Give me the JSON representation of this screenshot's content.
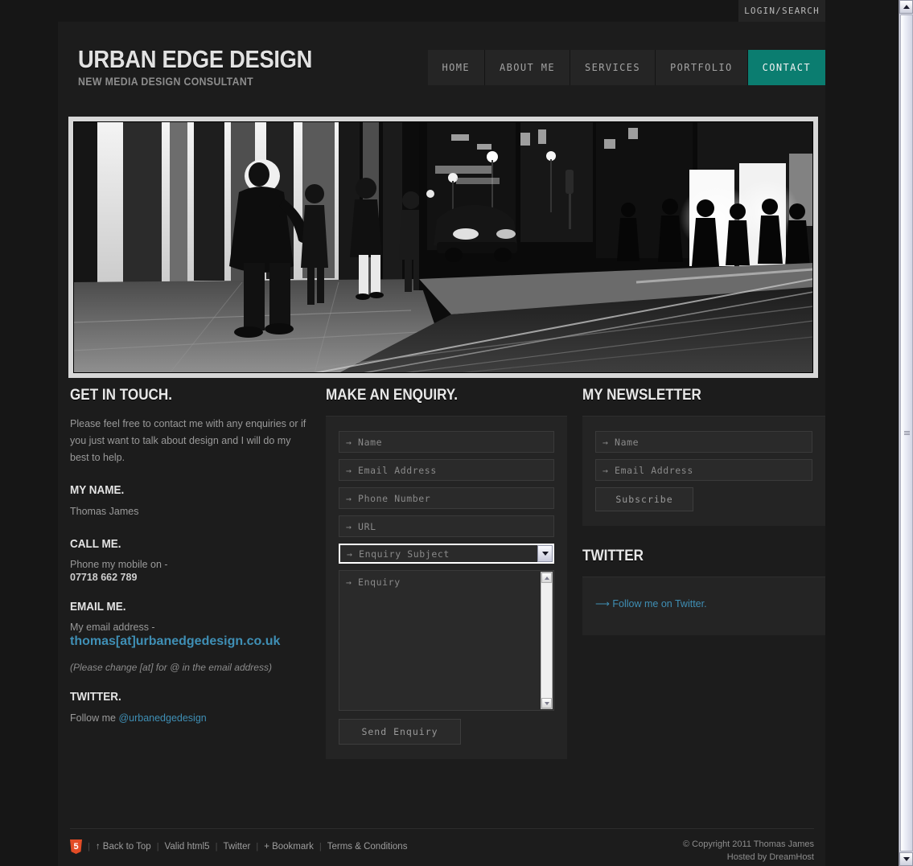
{
  "topbar": {
    "login_search": "LOGIN/SEARCH"
  },
  "brand": {
    "title": "URBAN EDGE DESIGN",
    "subtitle": "NEW MEDIA DESIGN CONSULTANT"
  },
  "nav": {
    "items": [
      {
        "label": "HOME",
        "active": false
      },
      {
        "label": "ABOUT ME",
        "active": false
      },
      {
        "label": "SERVICES",
        "active": false
      },
      {
        "label": "PORTFOLIO",
        "active": false
      },
      {
        "label": "CONTACT",
        "active": true
      }
    ],
    "active_color": "#0b7d70"
  },
  "hero": {
    "alt": "Black and white night street scene with scooter, pedestrians and tram tracks"
  },
  "contact": {
    "heading": "GET IN TOUCH.",
    "intro": "Please feel free to contact me with any enquiries or if you just want to talk about design and I will do my best to help.",
    "name_heading": "MY NAME.",
    "name_value": "Thomas James",
    "call_heading": "CALL ME.",
    "call_text": "Phone my mobile on -",
    "phone": "07718 662 789",
    "email_heading": "EMAIL ME.",
    "email_text": "My email address -",
    "email_link": "thomas[at]urbanedgedesign.co.uk",
    "email_note": "(Please change [at] for @ in the email address)",
    "twitter_heading": "TWITTER.",
    "twitter_prefix": "Follow me ",
    "twitter_handle": "@urbanedgedesign"
  },
  "enquiry": {
    "heading": "MAKE AN ENQUIRY.",
    "fields": {
      "name": "→ Name",
      "email": "→ Email Address",
      "phone": "→ Phone Number",
      "url": "→ URL",
      "subject": "→ Enquiry Subject",
      "message": "→ Enquiry"
    },
    "subject_options": [
      "→ Enquiry Subject"
    ],
    "subject_selected": "→ Enquiry Subject",
    "submit": "Send Enquiry"
  },
  "newsletter": {
    "heading": "MY NEWSLETTER",
    "name_placeholder": "→ Name",
    "email_placeholder": "→ Email Address",
    "submit": "Subscribe"
  },
  "twitter_box": {
    "heading": "TWITTER",
    "link": "⟶ Follow me on Twitter."
  },
  "footer": {
    "badge": "5",
    "links": [
      "↑ Back to Top",
      "Valid html5",
      "Twitter",
      "+ Bookmark",
      "Terms & Conditions"
    ],
    "separator": "|",
    "copyright": "© Copyright 2011 Thomas James",
    "host": "Hosted by DreamHost"
  }
}
